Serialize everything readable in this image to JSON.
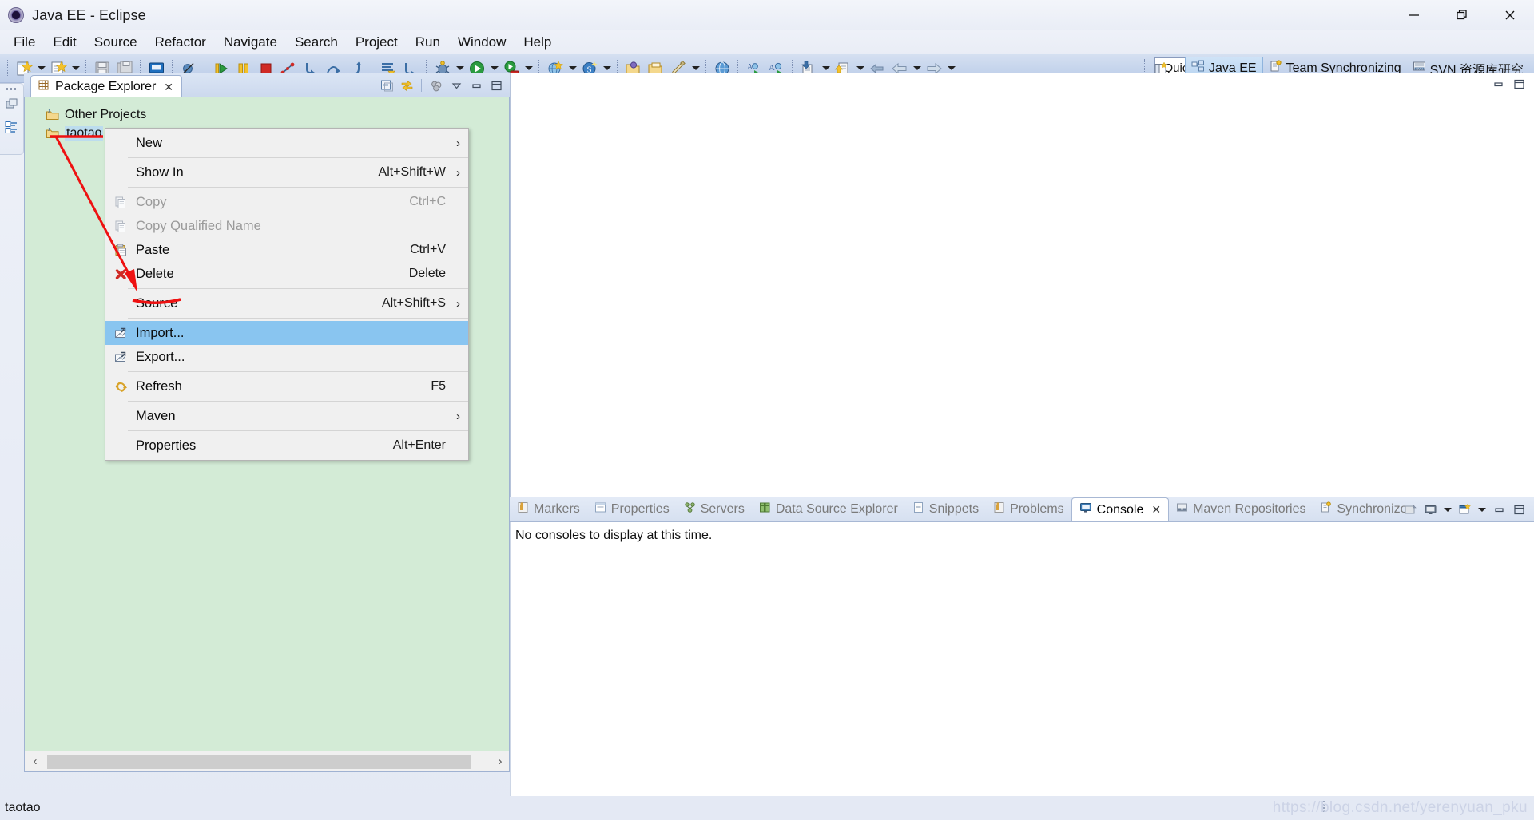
{
  "window": {
    "title": "Java EE - Eclipse",
    "app_icon": "eclipse-icon",
    "controls": {
      "minimize": "minimize-icon",
      "restore": "restore-icon",
      "close": "close-icon"
    }
  },
  "menubar": {
    "items": [
      {
        "label": "File"
      },
      {
        "label": "Edit"
      },
      {
        "label": "Source"
      },
      {
        "label": "Refactor"
      },
      {
        "label": "Navigate"
      },
      {
        "label": "Search"
      },
      {
        "label": "Project"
      },
      {
        "label": "Run"
      },
      {
        "label": "Window"
      },
      {
        "label": "Help"
      }
    ]
  },
  "toolbar": {
    "quick_access": "Quick Access",
    "perspectives": [
      {
        "label": "Java EE",
        "icon": "java-ee-perspective-icon",
        "active": true
      },
      {
        "label": "Team Synchronizing",
        "icon": "team-sync-perspective-icon",
        "active": false
      },
      {
        "label": "SVN 资源库研究",
        "icon": "svn-perspective-icon",
        "active": false
      }
    ],
    "open_perspective": "open-perspective-icon"
  },
  "package_explorer": {
    "tab_label": "Package Explorer",
    "tab_icon": "package-explorer-icon",
    "close_glyph": "✕",
    "tools": [
      "collapse-all-icon",
      "link-with-editor-icon",
      "view-menu-icon",
      "minimize-icon",
      "maximize-icon"
    ],
    "tree": [
      {
        "label": "Other Projects",
        "icon": "project-folder-icon",
        "selected": false,
        "indent": 0
      },
      {
        "label": "taotao",
        "icon": "project-folder-icon",
        "selected": true,
        "indent": 0
      }
    ],
    "scroll_left_glyph": "‹",
    "scroll_right_glyph": "›"
  },
  "context_menu": {
    "items": [
      {
        "label": "New",
        "shortcut": "",
        "submenu": true,
        "icon": "",
        "disabled": false,
        "highlight": false,
        "separator_after": true
      },
      {
        "label": "Show In",
        "shortcut": "Alt+Shift+W",
        "submenu": true,
        "icon": "",
        "disabled": false,
        "highlight": false,
        "separator_after": true
      },
      {
        "label": "Copy",
        "shortcut": "Ctrl+C",
        "submenu": false,
        "icon": "copy-icon",
        "disabled": true,
        "highlight": false,
        "separator_after": false
      },
      {
        "label": "Copy Qualified Name",
        "shortcut": "",
        "submenu": false,
        "icon": "copy-qualified-name-icon",
        "disabled": true,
        "highlight": false,
        "separator_after": false
      },
      {
        "label": "Paste",
        "shortcut": "Ctrl+V",
        "submenu": false,
        "icon": "paste-icon",
        "disabled": false,
        "highlight": false,
        "separator_after": false
      },
      {
        "label": "Delete",
        "shortcut": "Delete",
        "submenu": false,
        "icon": "delete-icon",
        "disabled": false,
        "highlight": false,
        "separator_after": true
      },
      {
        "label": "Source",
        "shortcut": "Alt+Shift+S",
        "submenu": true,
        "icon": "",
        "disabled": false,
        "highlight": false,
        "separator_after": true
      },
      {
        "label": "Import...",
        "shortcut": "",
        "submenu": false,
        "icon": "import-icon",
        "disabled": false,
        "highlight": true,
        "separator_after": false
      },
      {
        "label": "Export...",
        "shortcut": "",
        "submenu": false,
        "icon": "export-icon",
        "disabled": false,
        "highlight": false,
        "separator_after": true
      },
      {
        "label": "Refresh",
        "shortcut": "F5",
        "submenu": false,
        "icon": "refresh-icon",
        "disabled": false,
        "highlight": false,
        "separator_after": true
      },
      {
        "label": "Maven",
        "shortcut": "",
        "submenu": true,
        "icon": "",
        "disabled": false,
        "highlight": false,
        "separator_after": true
      },
      {
        "label": "Properties",
        "shortcut": "Alt+Enter",
        "submenu": false,
        "icon": "",
        "disabled": false,
        "highlight": false,
        "separator_after": false
      }
    ]
  },
  "bottom_panel": {
    "tabs": [
      {
        "label": "Markers",
        "icon": "markers-icon",
        "active": false
      },
      {
        "label": "Properties",
        "icon": "properties-icon",
        "active": false
      },
      {
        "label": "Servers",
        "icon": "servers-icon",
        "active": false
      },
      {
        "label": "Data Source Explorer",
        "icon": "data-source-explorer-icon",
        "active": false
      },
      {
        "label": "Snippets",
        "icon": "snippets-icon",
        "active": false
      },
      {
        "label": "Problems",
        "icon": "problems-icon",
        "active": false
      },
      {
        "label": "Console",
        "icon": "console-icon",
        "active": true
      },
      {
        "label": "Maven Repositories",
        "icon": "maven-repositories-icon",
        "active": false
      },
      {
        "label": "Synchronize",
        "icon": "synchronize-icon",
        "active": false
      }
    ],
    "active_tab_close_glyph": "✕",
    "console_message": "No consoles to display at this time.",
    "tools": [
      "pin-console-icon",
      "display-selected-console-icon",
      "open-console-icon",
      "minimize-icon",
      "maximize-icon"
    ]
  },
  "statusbar": {
    "text": "taotao",
    "watermark": "https://blog.csdn.net/yerenyuan_pku"
  },
  "colors": {
    "tree_background": "#d3ebd6",
    "menu_highlight": "#89c5f0",
    "selection": "#bcdcee",
    "annotation": "#ee1111",
    "toolbar": "#c5d4ec",
    "titlebar": "#eef1f8"
  }
}
